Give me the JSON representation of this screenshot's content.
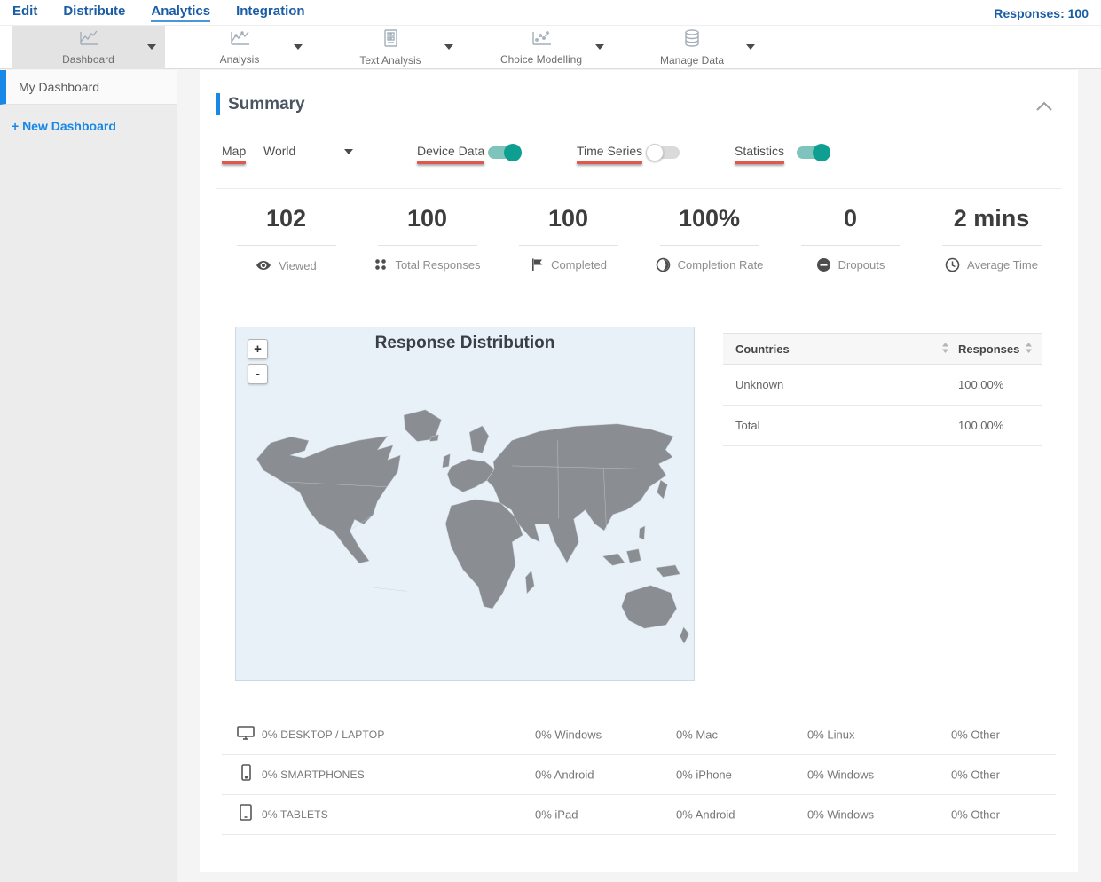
{
  "topnav": {
    "items": [
      "Edit",
      "Distribute",
      "Analytics",
      "Integration"
    ],
    "active": "Analytics",
    "responses_label": "Responses: 100"
  },
  "toolbar": {
    "items": [
      {
        "label": "Dashboard",
        "icon": "line-chart-icon",
        "active": true
      },
      {
        "label": "Analysis",
        "icon": "line-chart-icon",
        "active": false
      },
      {
        "label": "Text Analysis",
        "icon": "document-grid-icon",
        "active": false
      },
      {
        "label": "Choice Modelling",
        "icon": "scatter-chart-icon",
        "active": false
      },
      {
        "label": "Manage Data",
        "icon": "database-icon",
        "active": false
      }
    ]
  },
  "sidebar": {
    "active_item": "My Dashboard",
    "new_button": "+ New Dashboard"
  },
  "summary": {
    "title": "Summary"
  },
  "controls": {
    "map_label": "Map",
    "map_value": "World",
    "device_data_label": "Device Data",
    "device_data_on": true,
    "time_series_label": "Time Series",
    "time_series_on": false,
    "statistics_label": "Statistics",
    "statistics_on": true,
    "accent_underline_color": "#e2574c",
    "toggle_on_color": "#0f9e92"
  },
  "stats": [
    {
      "value": "102",
      "label": "Viewed",
      "icon": "eye-icon"
    },
    {
      "value": "100",
      "label": "Total Responses",
      "icon": "dots-grid-icon"
    },
    {
      "value": "100",
      "label": "Completed",
      "icon": "flag-icon"
    },
    {
      "value": "100%",
      "label": "Completion Rate",
      "icon": "contrast-circle-icon"
    },
    {
      "value": "0",
      "label": "Dropouts",
      "icon": "minus-circle-icon"
    },
    {
      "value": "2 mins",
      "label": "Average Time",
      "icon": "clock-icon"
    }
  ],
  "map": {
    "title": "Response Distribution",
    "zoom_in": "+",
    "zoom_out": "-",
    "land_color": "#8a8e93",
    "sea_color": "#e9f1f8"
  },
  "countries_table": {
    "headers": [
      "Countries",
      "Responses"
    ],
    "rows": [
      [
        "Unknown",
        "100.00%"
      ],
      [
        "Total",
        "100.00%"
      ]
    ]
  },
  "device_table": {
    "rows": [
      {
        "icon": "desktop-icon",
        "label": "0% DESKTOP / LAPTOP",
        "cols": [
          "0% Windows",
          "0% Mac",
          "0% Linux",
          "0% Other"
        ]
      },
      {
        "icon": "smartphone-icon",
        "label": "0% SMARTPHONES",
        "cols": [
          "0% Android",
          "0% iPhone",
          "0% Windows",
          "0% Other"
        ]
      },
      {
        "icon": "tablet-icon",
        "label": "0% TABLETS",
        "cols": [
          "0% iPad",
          "0% Android",
          "0% Windows",
          "0% Other"
        ]
      }
    ]
  }
}
